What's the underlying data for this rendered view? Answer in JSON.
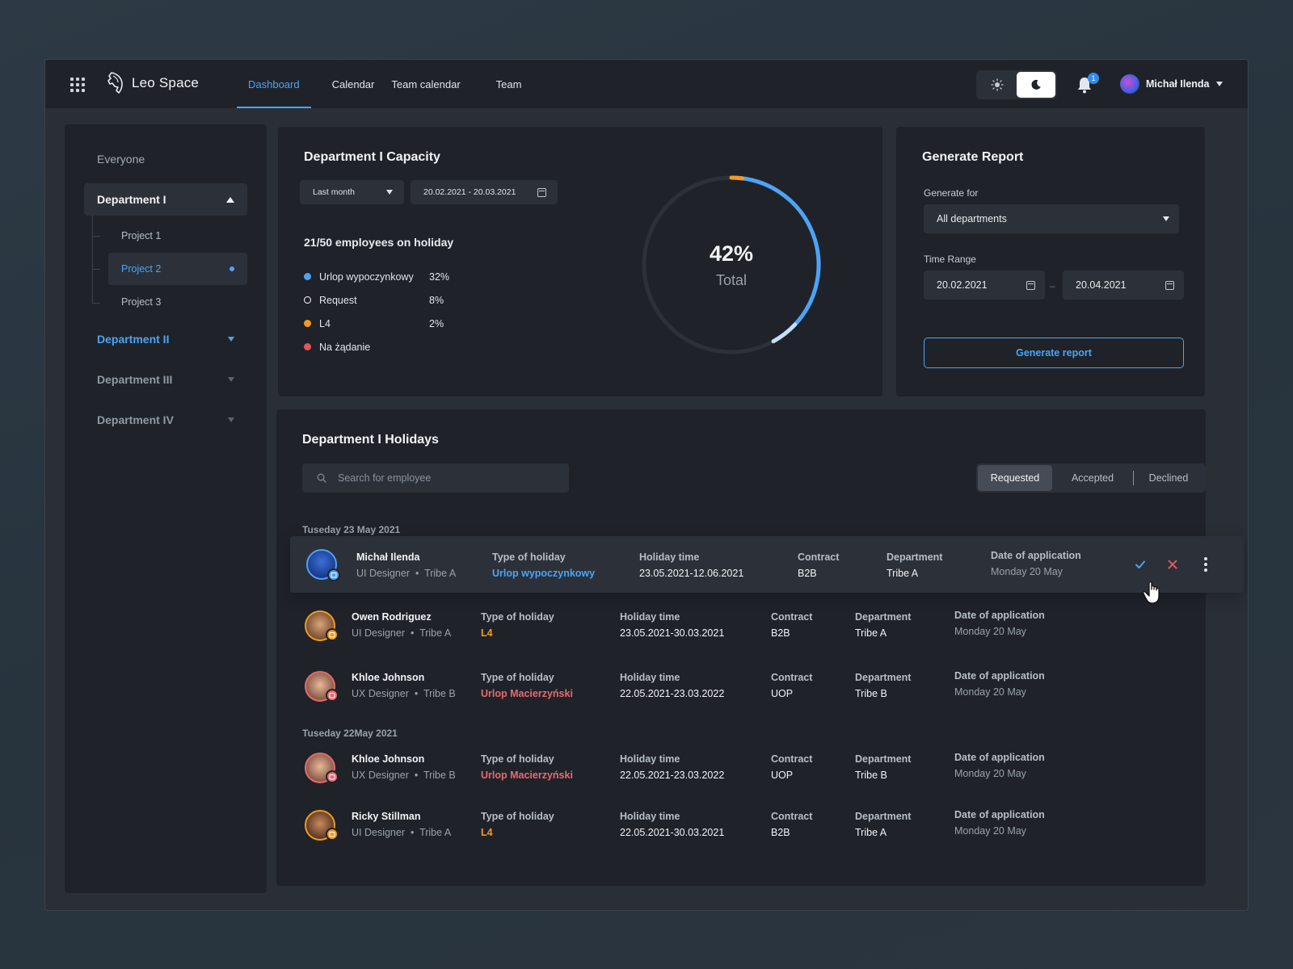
{
  "app": {
    "name": "Leo Space"
  },
  "nav": [
    {
      "label": "Dashboard",
      "active": true
    },
    {
      "label": "Calendar",
      "active": false
    },
    {
      "label": "Team calendar",
      "active": false
    },
    {
      "label": "Team",
      "active": false
    }
  ],
  "notifications": {
    "count": "1"
  },
  "user": {
    "name": "Michał Ilenda"
  },
  "sidebar": {
    "everyone": "Everyone",
    "departments": [
      {
        "label": "Department I",
        "state": "open"
      },
      {
        "label": "Department II",
        "state": "blue"
      },
      {
        "label": "Department III",
        "state": "gray"
      },
      {
        "label": "Department IV",
        "state": "gray"
      }
    ],
    "projects": [
      {
        "label": "Project 1",
        "active": false
      },
      {
        "label": "Project 2",
        "active": true
      },
      {
        "label": "Project 3",
        "active": false
      }
    ]
  },
  "capacity": {
    "title": "Department I Capacity",
    "period": "Last month",
    "date_range": "20.02.2021 - 20.03.2021",
    "holiday_summary": "21/50 employees on holiday",
    "legend": [
      {
        "label": "Urlop wypoczynkowy",
        "value": "32%",
        "color": "#4da3f5",
        "hollow": false
      },
      {
        "label": "Request",
        "value": "8%",
        "color": "#ffffff",
        "hollow": true
      },
      {
        "label": "L4",
        "value": "2%",
        "color": "#f39a1c",
        "hollow": false
      },
      {
        "label": "Na żądanie",
        "value": "",
        "color": "#e5545c",
        "hollow": false
      }
    ],
    "total_value": "42%",
    "total_label": "Total",
    "total_fraction": 0.42
  },
  "report": {
    "title": "Generate Report",
    "generate_for_label": "Generate for",
    "generate_for_value": "All departments",
    "time_range_label": "Time Range",
    "from": "20.02.2021",
    "to": "20.04.2021",
    "button": "Generate report"
  },
  "holidays": {
    "title": "Department I  Holidays",
    "search_placeholder": "Search for employee",
    "tabs": [
      {
        "label": "Requested",
        "active": true
      },
      {
        "label": "Accepted",
        "active": false
      },
      {
        "label": "Declined",
        "active": false
      }
    ],
    "col_type": "Type of holiday",
    "col_time": "Holiday time",
    "col_contract": "Contract",
    "col_department": "Department",
    "col_date": "Date of application",
    "groups": [
      {
        "date": "Tuseday 23 May 2021",
        "rows": [
          {
            "name": "Michał Ilenda",
            "role": "UI Designer",
            "tribe": "Tribe A",
            "type": "Urlop wypoczynkowy",
            "type_color": "#4da3f5",
            "time": "23.05.2021-12.06.2021",
            "contract": "B2B",
            "department": "Tribe A",
            "applied": "Monday 20 May",
            "highlight": true
          },
          {
            "name": "Owen Rodriguez",
            "role": "UI Designer",
            "tribe": "Tribe A",
            "type": "L4",
            "type_color": "#f39a1c",
            "time": "23.05.2021-30.03.2021",
            "contract": "B2B",
            "department": "Tribe A",
            "applied": "Monday 20 May",
            "highlight": false
          },
          {
            "name": "Khloe Johnson",
            "role": "UX Designer",
            "tribe": "Tribe B",
            "type": "Urlop Macierzyński",
            "type_color": "#e86a70",
            "time": "22.05.2021-23.03.2022",
            "contract": "UOP",
            "department": "Tribe B",
            "applied": "Monday 20 May",
            "highlight": false
          }
        ]
      },
      {
        "date": "Tuseday 22May 2021",
        "rows": [
          {
            "name": "Khloe Johnson",
            "role": "UX Designer",
            "tribe": "Tribe B",
            "type": "Urlop Macierzyński",
            "type_color": "#e86a70",
            "time": "22.05.2021-23.03.2022",
            "contract": "UOP",
            "department": "Tribe B",
            "applied": "Monday 20 May",
            "highlight": false
          },
          {
            "name": "Ricky Stillman",
            "role": "UI Designer",
            "tribe": "Tribe A",
            "type": "L4",
            "type_color": "#f39a1c",
            "time": "22.05.2021-30.03.2021",
            "contract": "B2B",
            "department": "Tribe A",
            "applied": "Monday 20 May",
            "highlight": false
          }
        ]
      }
    ]
  }
}
